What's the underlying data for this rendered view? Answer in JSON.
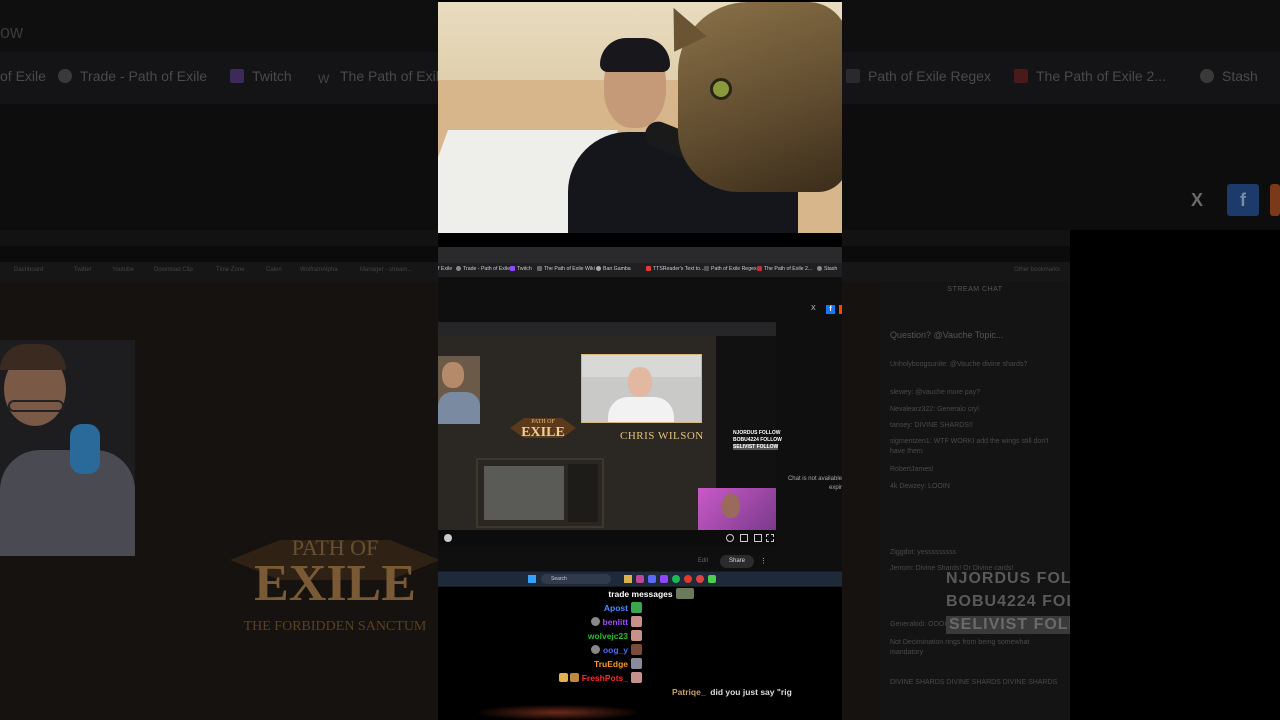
{
  "background": {
    "window_title_fragment": "ow",
    "bookmarks": [
      {
        "label": "of Exile"
      },
      {
        "label": "Trade - Path of Exile"
      },
      {
        "label": "Twitch"
      },
      {
        "label": "The Path of Exile"
      },
      {
        "label": "Path of Exile Regex"
      },
      {
        "label": "The Path of Exile 2..."
      },
      {
        "label": "Stash"
      }
    ],
    "social": {
      "x": "X",
      "facebook": "f"
    },
    "tiny_bookmarks": [
      "Dashboard",
      "Twitter",
      "Youtube",
      "Download Clip",
      "Time Zone",
      "Calen",
      "WolframAlpha",
      "Manager - stream...",
      "Other bookmarks"
    ],
    "chat": {
      "header": "STREAM CHAT",
      "pinned": "Question? @Vauche Topic...",
      "lines": [
        "Unholyboogsunite: @Vauche divine shards?",
        "slewey: @vauche more pay?",
        "Nevalearz322: Generalo cry!",
        "tansey: DIVINE SHARDS!!",
        "sigmentzen1: WTF WORKI add the wings still don't have them",
        "RobertJames!",
        "4k Dewzey: LOOIN",
        "Ziggdot: yesssssssss",
        "Jerrom: Divine Shards! Or Divine cards!",
        "Generalodi: OOOORH!",
        "Not Decimination rings from being somewhat mandatory",
        "DIVINE SHARDS DIVINE SHARDS DIVINE SHARDS"
      ],
      "follows": [
        "NJORDUS FOLLOW",
        "BOBU4224 FOLLOW",
        "SELIVIST FOLLOW"
      ]
    }
  },
  "capture": {
    "bookmarks": [
      {
        "label": "f Exile"
      },
      {
        "label": "Trade - Path of Exile"
      },
      {
        "label": "Twitch"
      },
      {
        "label": "The Path of Exile Wiki"
      },
      {
        "label": "Ban Gamba"
      },
      {
        "label": "TTSReader's Text to..."
      },
      {
        "label": "Path of Exile Regex"
      },
      {
        "label": "The Path of Exile 2..."
      },
      {
        "label": "Stash"
      }
    ],
    "inner_stream": {
      "name_plate": "CHRIS WILSON",
      "logo_top": "PATH OF",
      "logo_main": "EXILE",
      "chat_follows": [
        "NJORDUS FOLLOW",
        "BOBU4224 FOLLOW",
        "SELIVIST FOLLOW"
      ]
    },
    "not_available": "Chat is not available expir",
    "edit_label": "Edit",
    "share_label": "Share",
    "taskbar_search": "Search"
  },
  "overlay_chat": {
    "title": "trade messages",
    "rows": [
      {
        "name": "Apost",
        "color": "#4a8cff"
      },
      {
        "name": "benlitt",
        "color": "#9b4cff"
      },
      {
        "name": "wolvejc23",
        "color": "#2bbd2b"
      },
      {
        "name": "oog_y",
        "color": "#4a6cff"
      },
      {
        "name": "TruEdge",
        "color": "#ff9a1f"
      },
      {
        "name": "FreshPots_",
        "color": "#ff2a2a"
      }
    ],
    "latest": {
      "user": "Patriqe_",
      "user_color": "#c8a064",
      "text": "did you just say \"rig"
    }
  }
}
